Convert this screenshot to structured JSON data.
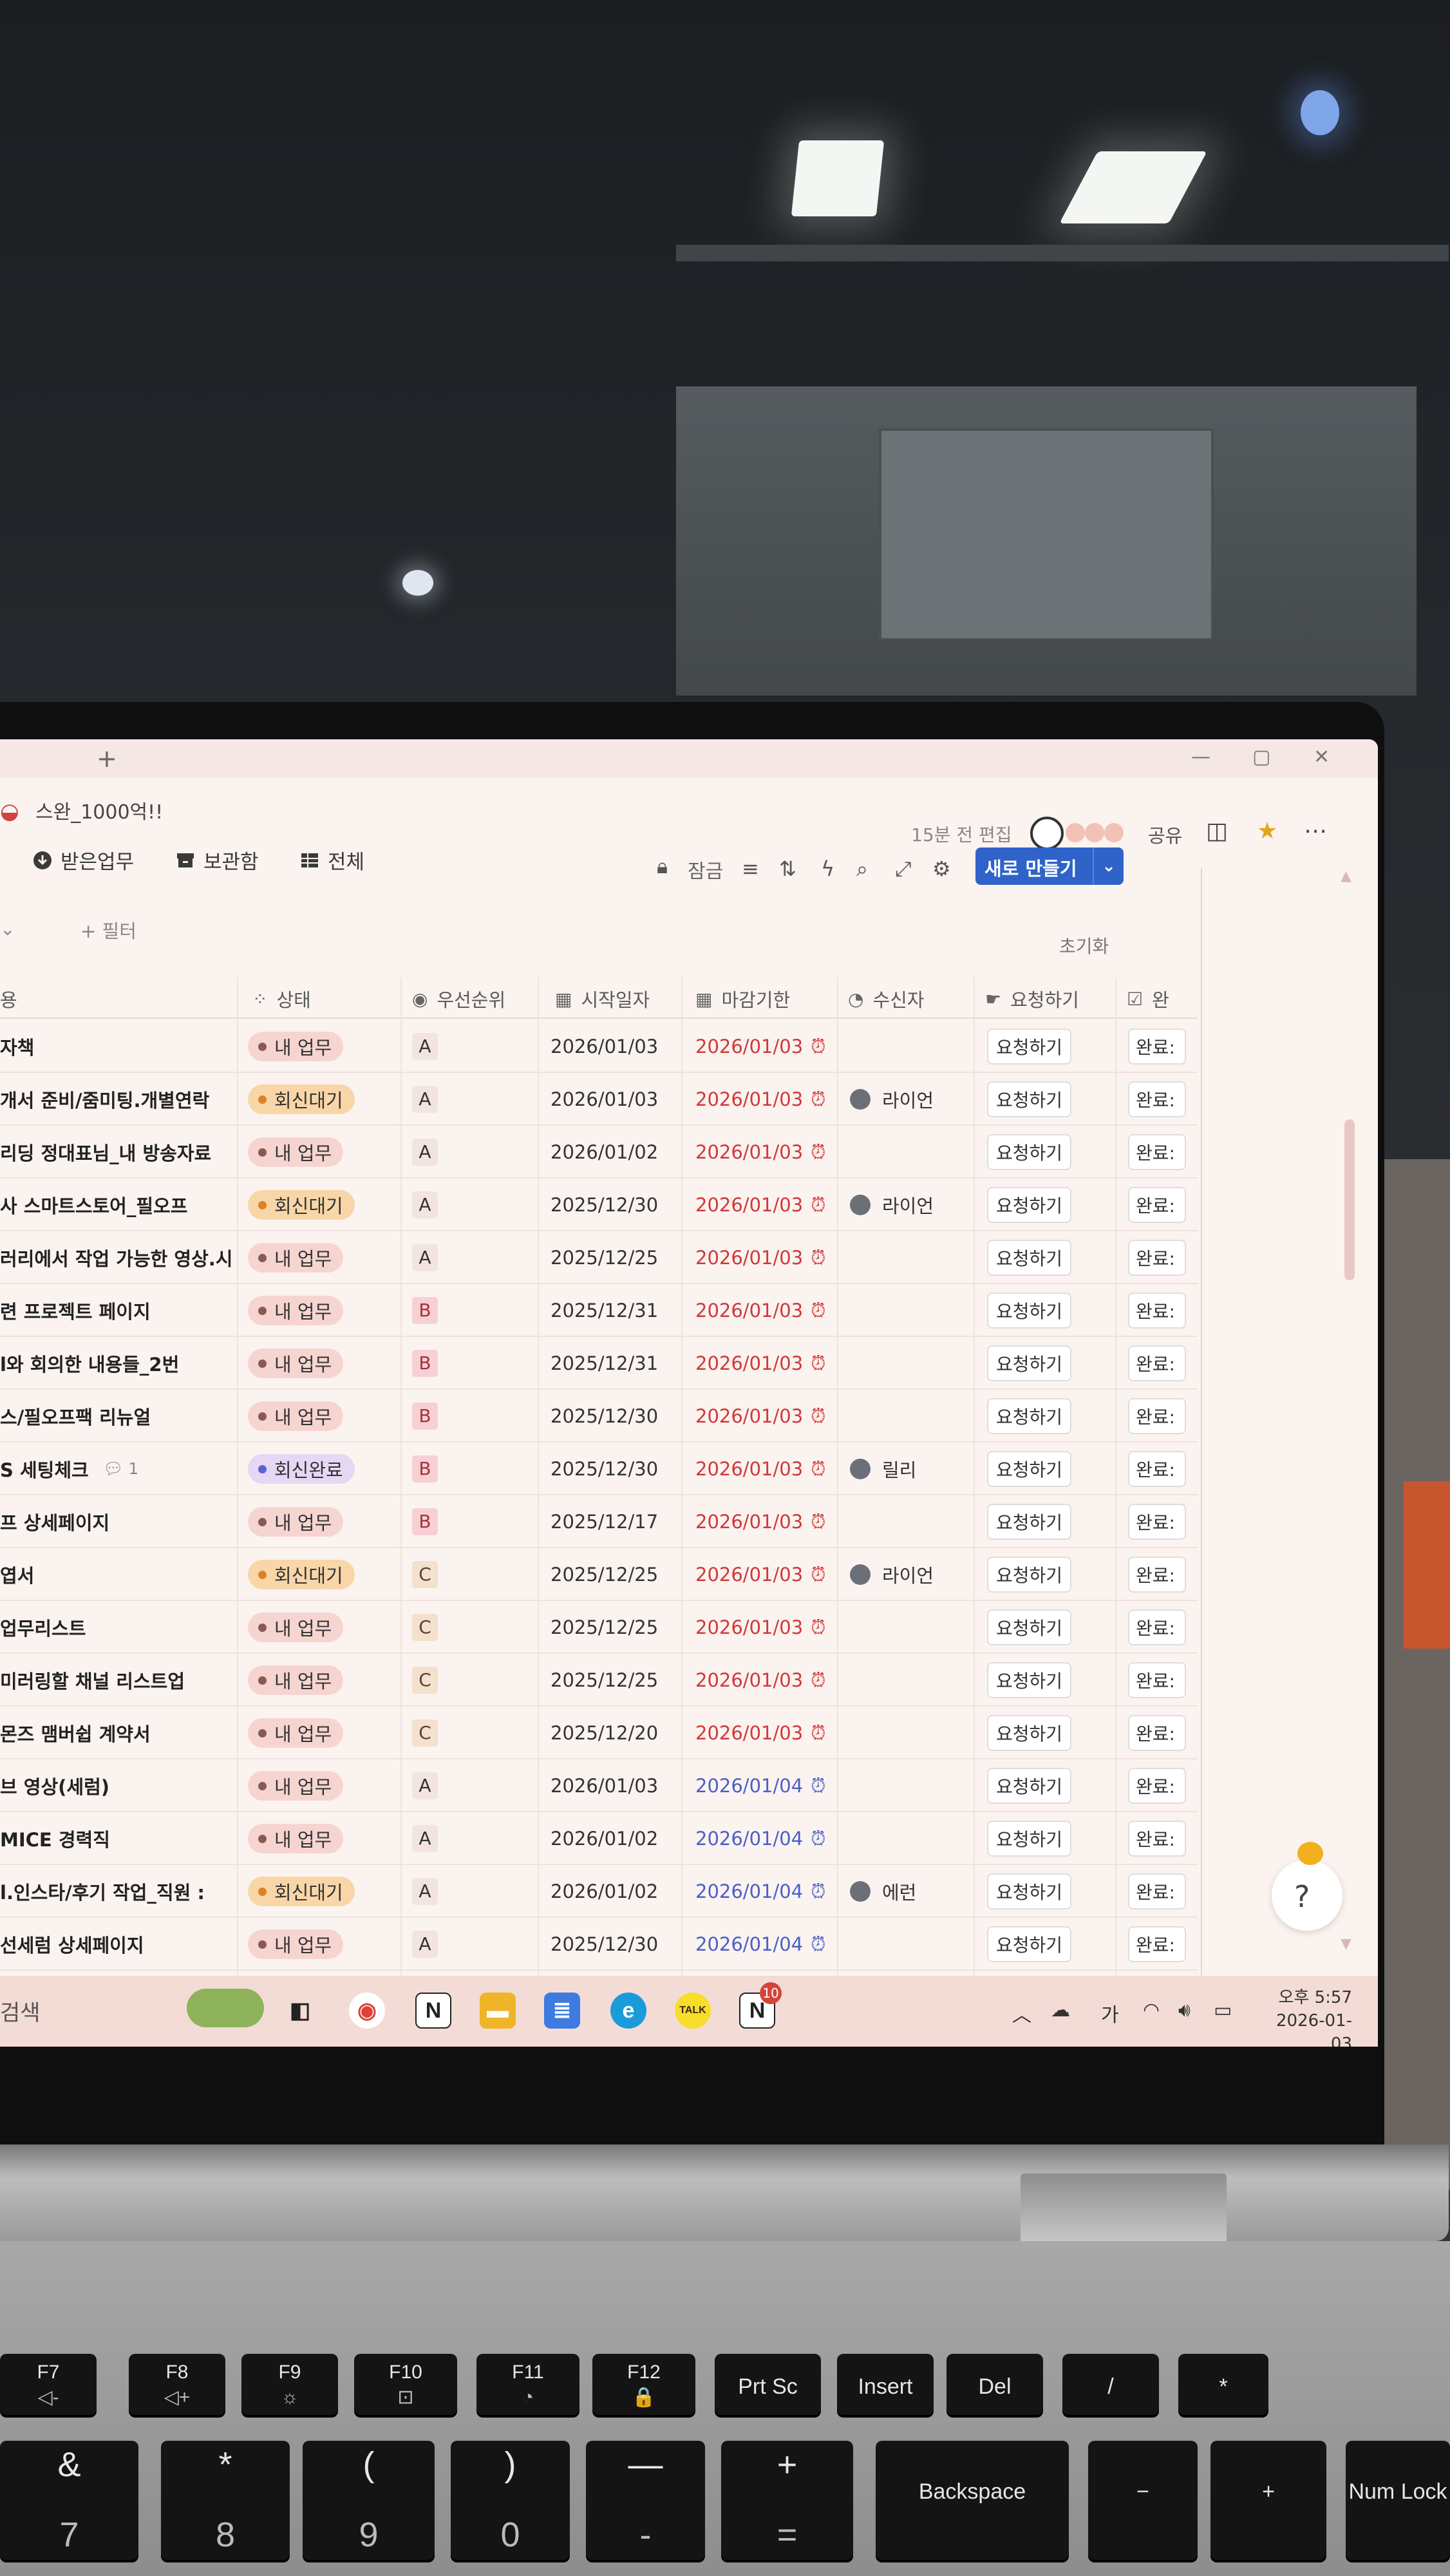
{
  "workspace": {
    "title": "스완_1000억!!"
  },
  "header": {
    "edited": "15분 전 편집",
    "share": "공유",
    "lock": "잠금",
    "new_button": "새로 만들기",
    "reset": "초기화",
    "add_filter": "+ 필터"
  },
  "views": [
    {
      "label": "받은업무",
      "icon": "download-circle-icon"
    },
    {
      "label": "보관함",
      "icon": "archive-icon"
    },
    {
      "label": "전체",
      "icon": "table-icon"
    }
  ],
  "columns": {
    "name": "용",
    "status": "상태",
    "priority": "우선순위",
    "start": "시작일자",
    "due": "마감기한",
    "receiver": "수신자",
    "request": "요청하기",
    "done": "완"
  },
  "rows": [
    {
      "name": "자책",
      "comment": "",
      "status": "내 업무",
      "priority": "A",
      "start": "2026/01/03",
      "due": "2026/01/03",
      "receiver": "",
      "request": "요청하기",
      "done": "완료:"
    },
    {
      "name": "개서 준비/줌미팅.개별연락",
      "comment": "",
      "status": "회신대기",
      "priority": "A",
      "start": "2026/01/03",
      "due": "2026/01/03",
      "receiver": "라이언",
      "request": "요청하기",
      "done": "완료:"
    },
    {
      "name": "리딩 정대표님_내 방송자료",
      "comment": "",
      "status": "내 업무",
      "priority": "A",
      "start": "2026/01/02",
      "due": "2026/01/03",
      "receiver": "",
      "request": "요청하기",
      "done": "완료:"
    },
    {
      "name": "사 스마트스토어_필오프",
      "comment": "",
      "status": "회신대기",
      "priority": "A",
      "start": "2025/12/30",
      "due": "2026/01/03",
      "receiver": "라이언",
      "request": "요청하기",
      "done": "완료:"
    },
    {
      "name": "러리에서 작업 가능한 영상.시",
      "comment": "",
      "status": "내 업무",
      "priority": "A",
      "start": "2025/12/25",
      "due": "2026/01/03",
      "receiver": "",
      "request": "요청하기",
      "done": "완료:"
    },
    {
      "name": "련 프로젝트 페이지",
      "comment": "",
      "status": "내 업무",
      "priority": "B",
      "start": "2025/12/31",
      "due": "2026/01/03",
      "receiver": "",
      "request": "요청하기",
      "done": "완료:"
    },
    {
      "name": "l와 회의한 내용들_2번",
      "comment": "",
      "status": "내 업무",
      "priority": "B",
      "start": "2025/12/31",
      "due": "2026/01/03",
      "receiver": "",
      "request": "요청하기",
      "done": "완료:"
    },
    {
      "name": "스/필오프팩 리뉴얼",
      "comment": "",
      "status": "내 업무",
      "priority": "B",
      "start": "2025/12/30",
      "due": "2026/01/03",
      "receiver": "",
      "request": "요청하기",
      "done": "완료:"
    },
    {
      "name": "S 세팅체크",
      "comment": "1",
      "status": "회신완료",
      "priority": "B",
      "start": "2025/12/30",
      "due": "2026/01/03",
      "receiver": "릴리",
      "request": "요청하기",
      "done": "완료:"
    },
    {
      "name": "프 상세페이지",
      "comment": "",
      "status": "내 업무",
      "priority": "B",
      "start": "2025/12/17",
      "due": "2026/01/03",
      "receiver": "",
      "request": "요청하기",
      "done": "완료:"
    },
    {
      "name": "엽서",
      "comment": "",
      "status": "회신대기",
      "priority": "C",
      "start": "2025/12/25",
      "due": "2026/01/03",
      "receiver": "라이언",
      "request": "요청하기",
      "done": "완료:"
    },
    {
      "name": "업무리스트",
      "comment": "",
      "status": "내 업무",
      "priority": "C",
      "start": "2025/12/25",
      "due": "2026/01/03",
      "receiver": "",
      "request": "요청하기",
      "done": "완료:"
    },
    {
      "name": "미러링할 채널 리스트업",
      "comment": "",
      "status": "내 업무",
      "priority": "C",
      "start": "2025/12/25",
      "due": "2026/01/03",
      "receiver": "",
      "request": "요청하기",
      "done": "완료:"
    },
    {
      "name": "몬즈 맴버쉽 계약서",
      "comment": "",
      "status": "내 업무",
      "priority": "C",
      "start": "2025/12/20",
      "due": "2026/01/03",
      "receiver": "",
      "request": "요청하기",
      "done": "완료:"
    },
    {
      "name": "브 영상(세럼)",
      "comment": "",
      "status": "내 업무",
      "priority": "A",
      "start": "2026/01/03",
      "due": "2026/01/04",
      "receiver": "",
      "request": "요청하기",
      "done": "완료:"
    },
    {
      "name": "MICE 경력직",
      "comment": "",
      "status": "내 업무",
      "priority": "A",
      "start": "2026/01/02",
      "due": "2026/01/04",
      "receiver": "",
      "request": "요청하기",
      "done": "완료:"
    },
    {
      "name": "l.인스타/후기 작업_직원 :",
      "comment": "",
      "status": "회신대기",
      "priority": "A",
      "start": "2026/01/02",
      "due": "2026/01/04",
      "receiver": "에런",
      "request": "요청하기",
      "done": "완료:"
    },
    {
      "name": "선세럼 상세페이지",
      "comment": "",
      "status": "내 업무",
      "priority": "A",
      "start": "2025/12/30",
      "due": "2026/01/04",
      "receiver": "",
      "request": "요청하기",
      "done": "완료:"
    }
  ],
  "status_colors": {
    "내 업무": {
      "bg": "#f6d5d0",
      "dot": "#8a5a52"
    },
    "회신대기": {
      "bg": "#f8d6a8",
      "dot": "#d9822b"
    },
    "회신완료": {
      "bg": "#e6d7f4",
      "dot": "#5b63d6"
    }
  },
  "priority_colors": {
    "A": {
      "bg": "#f1e4e1",
      "fg": "#333333"
    },
    "B": {
      "bg": "#f7d0d4",
      "fg": "#a3333a"
    },
    "C": {
      "bg": "#f3e0cd",
      "fg": "#5a4030"
    }
  },
  "due_colors": {
    "overdue": "#d0383a",
    "upcoming": "#4a5fc8"
  },
  "taskbar": {
    "search": "검색",
    "apps": [
      "task-view",
      "chrome",
      "notion",
      "file-explorer",
      "notepad",
      "edge",
      "kakaotalk",
      "notion-active"
    ],
    "notion_badge": "10",
    "ime": "가",
    "clock_line1": "오후 5:57",
    "clock_line2": "2026-01-03"
  },
  "keyboard": {
    "frow": [
      {
        "top": "F7",
        "sub": "◁-"
      },
      {
        "top": "F8",
        "sub": "◁+"
      },
      {
        "top": "F9",
        "sub": "☼"
      },
      {
        "top": "F10",
        "sub": "⊡"
      },
      {
        "top": "F11",
        "sub": "◔"
      },
      {
        "top": "F12",
        "sub": "🔒"
      },
      {
        "top": "Prt Sc",
        "sub": ""
      },
      {
        "top": "Insert",
        "sub": ""
      },
      {
        "top": "Del",
        "sub": ""
      },
      {
        "top": "/",
        "sub": ""
      },
      {
        "top": "*",
        "sub": ""
      }
    ],
    "numrow": [
      {
        "top": "&",
        "sub": "7"
      },
      {
        "top": "*",
        "sub": "8"
      },
      {
        "top": "(",
        "sub": "9"
      },
      {
        "top": ")",
        "sub": "0"
      },
      {
        "top": "—",
        "sub": "-"
      },
      {
        "top": "+",
        "sub": "="
      },
      {
        "top": "Backspace",
        "sub": ""
      },
      {
        "top": "−",
        "sub": ""
      },
      {
        "top": "+",
        "sub": ""
      },
      {
        "top": "Num Lock",
        "sub": ""
      }
    ]
  }
}
